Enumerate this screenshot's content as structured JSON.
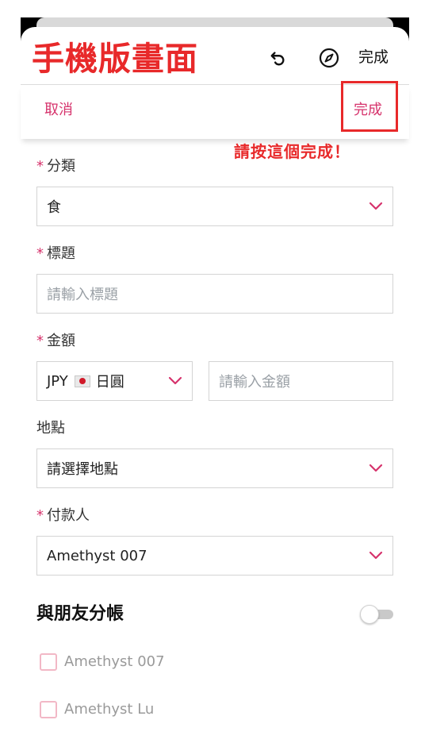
{
  "header": {
    "title": "手機版畫面",
    "done_label": "完成",
    "icons": [
      "undo-icon",
      "compass-icon"
    ]
  },
  "nav": {
    "cancel_label": "取消",
    "done_label": "完成"
  },
  "annotation": {
    "text": "請按這個完成！",
    "color": "#e8292a"
  },
  "form": {
    "category": {
      "label": "分類",
      "required": "*",
      "value": "食"
    },
    "title": {
      "label": "標題",
      "required": "*",
      "placeholder": "請輸入標題"
    },
    "amount": {
      "label": "金額",
      "required": "*",
      "currency_code": "JPY",
      "currency_name": "日圓",
      "placeholder": "請輸入金額"
    },
    "location": {
      "label": "地點",
      "value": "請選擇地點"
    },
    "payer": {
      "label": "付款人",
      "required": "*",
      "value": "Amethyst 007"
    }
  },
  "split": {
    "title": "與朋友分帳",
    "toggle_on": false,
    "friends": [
      {
        "name": "Amethyst 007",
        "checked": false
      },
      {
        "name": "Amethyst Lu",
        "checked": false
      }
    ]
  },
  "colors": {
    "accent": "#d6336c",
    "annotation": "#e8292a",
    "border": "#d4d4d4"
  }
}
